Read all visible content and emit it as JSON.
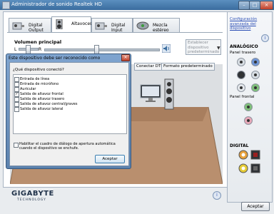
{
  "window": {
    "title": "Administrador de sonido Realtek HD",
    "minimize": "–",
    "maximize": "□",
    "close": "×"
  },
  "tabs": [
    {
      "label": "Digital Output"
    },
    {
      "label": "Altavoces"
    },
    {
      "label": "Digital Input"
    },
    {
      "label": "Mezcla estéreo"
    }
  ],
  "volume": {
    "label": "Volumen principal",
    "left": "L",
    "right": "R",
    "level": 0.45
  },
  "set_default": {
    "label": "Establecer dispositivo predeterminado"
  },
  "inner_tabs": [
    "Conectar DTS",
    "Formato predeterminado"
  ],
  "right_panel": {
    "advanced_link": "Configuración avanzada del dispositivo",
    "info": "i",
    "analog": "ANALÓGICO",
    "rear_panel": "Panel trasero",
    "front_panel": "Panel frontal",
    "digital": "DIGITAL"
  },
  "logo": {
    "brand": "GIGABYTE",
    "sub": "TECHNOLOGY"
  },
  "bottom": {
    "info": "i",
    "ok": "Aceptar"
  },
  "dialog": {
    "title": "Este dispositivo debe ser reconocido como",
    "close": "×",
    "question": "¿Qué dispositivo conectó?",
    "options": [
      {
        "label": "Entrada de línea",
        "checked": false
      },
      {
        "label": "Entrada de micrófono",
        "checked": false
      },
      {
        "label": "Auricular",
        "checked": false
      },
      {
        "label": "Salida de altavoz frontal",
        "checked": true
      },
      {
        "label": "Salida de altavoz trasero",
        "checked": false
      },
      {
        "label": "Salida de altavoz central/graves",
        "checked": false
      },
      {
        "label": "Salida de altavoz lateral",
        "checked": false
      }
    ],
    "auto_popup": "Habilitar el cuadro de diálogo de apertura automática cuando el dispositivo se enchufe.",
    "ok": "Aceptar"
  },
  "colors": {
    "accent": "#3a6c9e",
    "link": "#2c4fb5",
    "floor": "#b98f6e"
  }
}
